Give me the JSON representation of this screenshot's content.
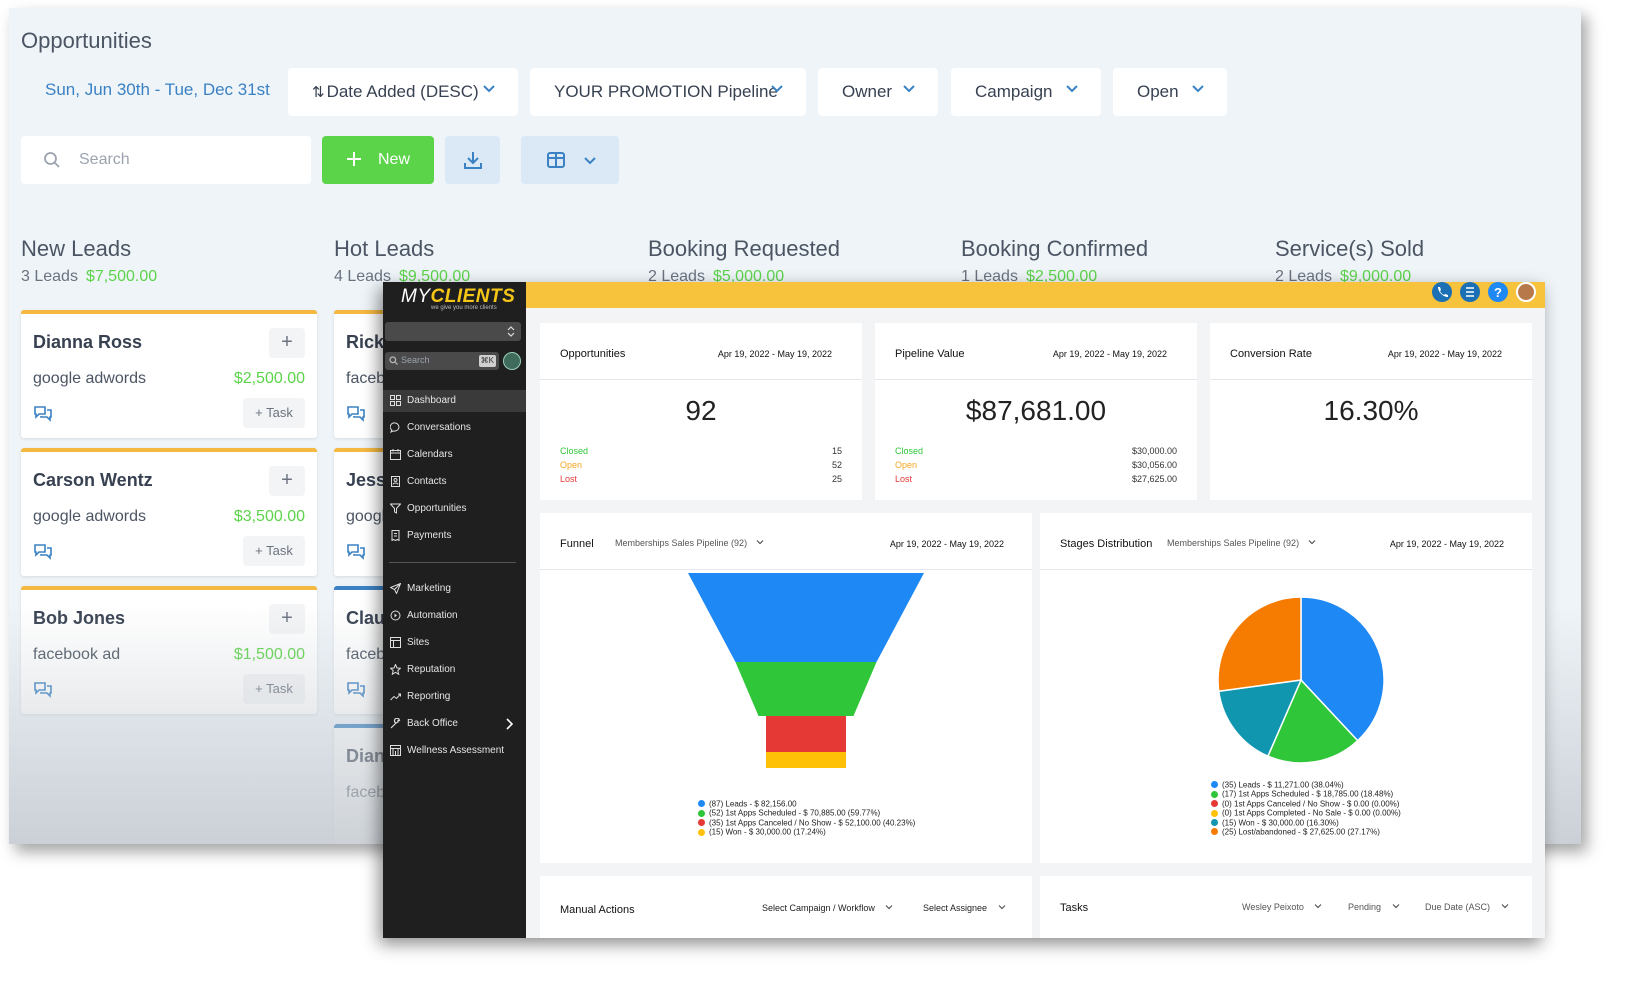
{
  "opportunities": {
    "title": "Opportunities",
    "date_range": "Sun, Jun 30th - Tue, Dec 31st",
    "filters": [
      {
        "label": "Date Added (DESC)"
      },
      {
        "label": "YOUR PROMOTION Pipeline"
      },
      {
        "label": "Owner"
      },
      {
        "label": "Campaign"
      },
      {
        "label": "Open"
      }
    ],
    "search_placeholder": "Search",
    "new_label": "New",
    "columns": [
      {
        "name": "New Leads",
        "count": "3 Leads",
        "amount": "$7,500.00"
      },
      {
        "name": "Hot Leads",
        "count": "4 Leads",
        "amount": "$9,500.00"
      },
      {
        "name": "Booking Requested",
        "count": "2 Leads",
        "amount": "$5,000.00"
      },
      {
        "name": "Booking Confirmed",
        "count": "1 Leads",
        "amount": "$2,500.00"
      },
      {
        "name": "Service(s) Sold",
        "count": "2 Leads",
        "amount": "$9,000.00"
      }
    ],
    "cards_col1": [
      {
        "name": "Dianna Ross",
        "source": "google adwords",
        "amount": "$2,500.00"
      },
      {
        "name": "Carson Wentz",
        "source": "google adwords",
        "amount": "$3,500.00"
      },
      {
        "name": "Bob Jones",
        "source": "facebook ad",
        "amount": "$1,500.00"
      }
    ],
    "cards_col2": [
      {
        "name": "Rick",
        "source": "faceb"
      },
      {
        "name": "Jess",
        "source": "googl"
      },
      {
        "name": "Clau",
        "source": "faceb"
      },
      {
        "name": "Dian",
        "source": "faceb"
      }
    ],
    "plus_label": "+",
    "task_label": "+ Task"
  },
  "dashboard": {
    "logo_my": "MY",
    "logo_clients": "CLIENTS",
    "logo_tagline": "we give you more clients",
    "sidebar_search": "Search",
    "sidebar_kbd": "⌘K",
    "nav": [
      {
        "label": "Dashboard",
        "icon": "grid-icon"
      },
      {
        "label": "Conversations",
        "icon": "chat-bubble-icon"
      },
      {
        "label": "Calendars",
        "icon": "calendar-icon"
      },
      {
        "label": "Contacts",
        "icon": "contacts-icon"
      },
      {
        "label": "Opportunities",
        "icon": "filter-icon"
      },
      {
        "label": "Payments",
        "icon": "receipt-icon"
      },
      {
        "label": "Marketing",
        "icon": "send-icon"
      },
      {
        "label": "Automation",
        "icon": "automation-icon"
      },
      {
        "label": "Sites",
        "icon": "globe-icon"
      },
      {
        "label": "Reputation",
        "icon": "star-icon"
      },
      {
        "label": "Reporting",
        "icon": "trend-icon"
      },
      {
        "label": "Back Office",
        "icon": "wrench-icon"
      },
      {
        "label": "Wellness Assessment",
        "icon": "building-icon"
      }
    ],
    "stats": [
      {
        "title": "Opportunities",
        "date": "Apr 19, 2022 - May 19, 2022",
        "value": "92",
        "rows": [
          {
            "k": "Closed",
            "v": "15"
          },
          {
            "k": "Open",
            "v": "52"
          },
          {
            "k": "Lost",
            "v": "25"
          }
        ]
      },
      {
        "title": "Pipeline Value",
        "date": "Apr 19, 2022 - May 19, 2022",
        "value": "$87,681.00",
        "rows": [
          {
            "k": "Closed",
            "v": "$30,000.00"
          },
          {
            "k": "Open",
            "v": "$30,056.00"
          },
          {
            "k": "Lost",
            "v": "$27,625.00"
          }
        ]
      },
      {
        "title": "Conversion Rate",
        "date": "Apr 19, 2022 - May 19, 2022",
        "value": "16.30%",
        "rows": []
      }
    ],
    "funnel": {
      "title": "Funnel",
      "pipeline": "Memberships Sales Pipeline (92)",
      "date": "Apr 19, 2022 - May 19, 2022",
      "legend": [
        "(87) Leads - $ 82,156.00",
        "(52) 1st Apps Scheduled - $ 70,885.00 (59.77%)",
        "(35) 1st Apps Canceled / No Show - $ 52,100.00 (40.23%)",
        "(15) Won - $ 30,000.00 (17.24%)"
      ]
    },
    "stages": {
      "title": "Stages Distribution",
      "pipeline": "Memberships Sales Pipeline (92)",
      "date": "Apr 19, 2022 - May 19, 2022",
      "legend": [
        "(35) Leads - $ 11,271.00 (38.04%)",
        "(17) 1st Apps Scheduled - $ 18,785.00 (18.48%)",
        "(0) 1st Apps Canceled / No Show - $ 0.00 (0.00%)",
        "(0) 1st Apps Completed - No Sale - $ 0.00 (0.00%)",
        "(15) Won - $ 30,000.00 (16.30%)",
        "(25) Lost/abandoned - $ 27,625.00 (27.17%)"
      ]
    },
    "manual": {
      "title": "Manual Actions",
      "campaign": "Select Campaign / Workflow",
      "assignee": "Select Assignee"
    },
    "tasks": {
      "title": "Tasks",
      "user": "Wesley Peixoto",
      "status": "Pending",
      "sort": "Due Date (ASC)"
    },
    "colors": {
      "blue": "#1e88f5",
      "green": "#2fc63a",
      "red": "#e53935",
      "yellow": "#ffc107",
      "teal": "#1196b0",
      "orange": "#f57c00",
      "accent": "#f8c33c"
    }
  },
  "chart_data": [
    {
      "type": "funnel",
      "categories": [
        "Leads",
        "1st Apps Scheduled",
        "1st Apps Canceled / No Show",
        "Won"
      ],
      "values": [
        87,
        52,
        35,
        15
      ],
      "amounts": [
        82156,
        70885,
        52100,
        30000
      ]
    },
    {
      "type": "pie",
      "categories": [
        "Leads",
        "1st Apps Scheduled",
        "1st Apps Canceled / No Show",
        "1st Apps Completed - No Sale",
        "Won",
        "Lost/abandoned"
      ],
      "values": [
        38.04,
        18.48,
        0,
        0,
        16.3,
        27.17
      ]
    }
  ]
}
